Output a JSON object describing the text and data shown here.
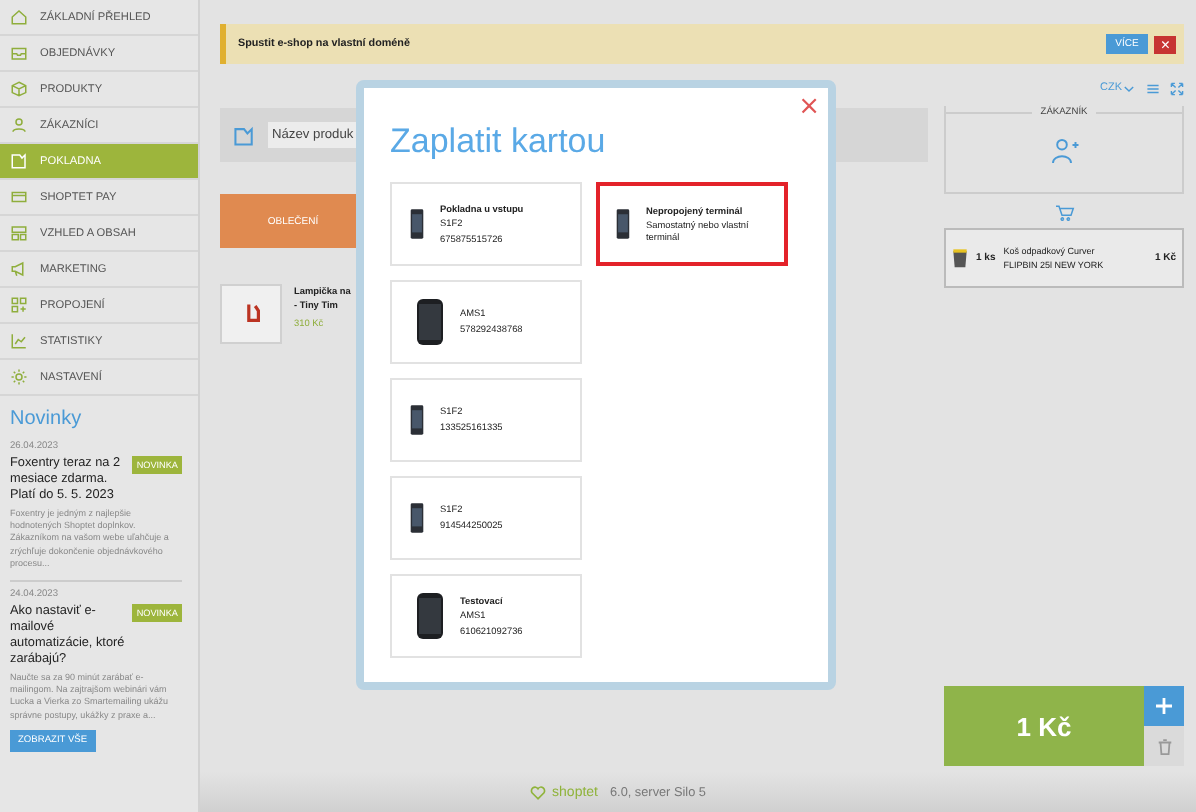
{
  "sidebar": {
    "items": [
      {
        "label": "ZÁKLADNÍ PŘEHLED",
        "selected": false
      },
      {
        "label": "OBJEDNÁVKY",
        "selected": false
      },
      {
        "label": "PRODUKTY",
        "selected": false
      },
      {
        "label": "ZÁKAZNÍCI",
        "selected": false
      },
      {
        "label": "POKLADNA",
        "selected": true
      },
      {
        "label": "SHOPTET PAY",
        "selected": false
      },
      {
        "label": "VZHLED A OBSAH",
        "selected": false
      },
      {
        "label": "MARKETING",
        "selected": false
      },
      {
        "label": "PROPOJENÍ",
        "selected": false
      },
      {
        "label": "STATISTIKY",
        "selected": false
      },
      {
        "label": "NASTAVENÍ",
        "selected": false
      }
    ]
  },
  "news": {
    "title": "Novinky",
    "items": [
      {
        "date": "26.04.2023",
        "title": "Foxentry teraz na 2 mesiace zdarma. Platí do 5. 5. 2023",
        "badge": "NOVINKA",
        "text": "Foxentry je jedným z najlepšie hodnotených Shoptet doplnkov. Zákazníkom na vašom webe uľahčuje a zrýchľuje dokončenie objednávkového procesu..."
      },
      {
        "date": "24.04.2023",
        "title": "Ako nastaviť e-mailové automatizácie, ktoré zarábajú?",
        "badge": "NOVINKA",
        "text": "Naučte sa za 90 minút zarábať e-mailingom. Na zajtrajšom webinári vám Lucka a Vierka zo Smartemailing ukážu správne postupy, ukážky z praxe a..."
      }
    ],
    "show_all": "ZOBRAZIT VŠE"
  },
  "banner": {
    "text": "Spustit e-shop na vlastní doméně",
    "button": "VÍCE",
    "close": "×"
  },
  "search": {
    "placeholder": "Název produk"
  },
  "categories": [
    {
      "label": "OBLEČENÍ",
      "color": "#e08a50"
    }
  ],
  "products": [
    {
      "name": "Lampička na",
      "name_2": "- Tiny Tim",
      "price": "310 Kč"
    }
  ],
  "toolbar": {
    "currency": "CZK"
  },
  "customer": {
    "legend": "ZÁKAZNÍK"
  },
  "cart": {
    "items": [
      {
        "qty": "1 ks",
        "name": "Koš odpadkový Curver FLIPBIN 25l NEW YORK",
        "price": "1 Kč"
      }
    ],
    "total": "1 Kč"
  },
  "footer": {
    "logo": "shoptet",
    "version": "6.0, server Silo 5"
  },
  "modal": {
    "title": "Zaplatit kartou",
    "close": "×",
    "terminals": [
      {
        "kind": "terminal",
        "name": "Pokladna u vstupu",
        "model": "S1F2",
        "serial": "675875515726",
        "selected": false
      },
      {
        "kind": "terminal",
        "name": "Nepropojený terminál",
        "model": "Samostatný nebo vlastní terminál",
        "selected": true
      },
      {
        "kind": "phone",
        "model": "AMS1",
        "serial": "578292438768",
        "selected": false
      },
      {
        "kind": "terminal",
        "model": "S1F2",
        "serial": "133525161335",
        "selected": false
      },
      {
        "kind": "terminal",
        "model": "S1F2",
        "serial": "914544250025",
        "selected": false
      },
      {
        "kind": "phone",
        "name": "Testovací",
        "model": "AMS1",
        "serial": "610621092736",
        "selected": false
      }
    ]
  }
}
